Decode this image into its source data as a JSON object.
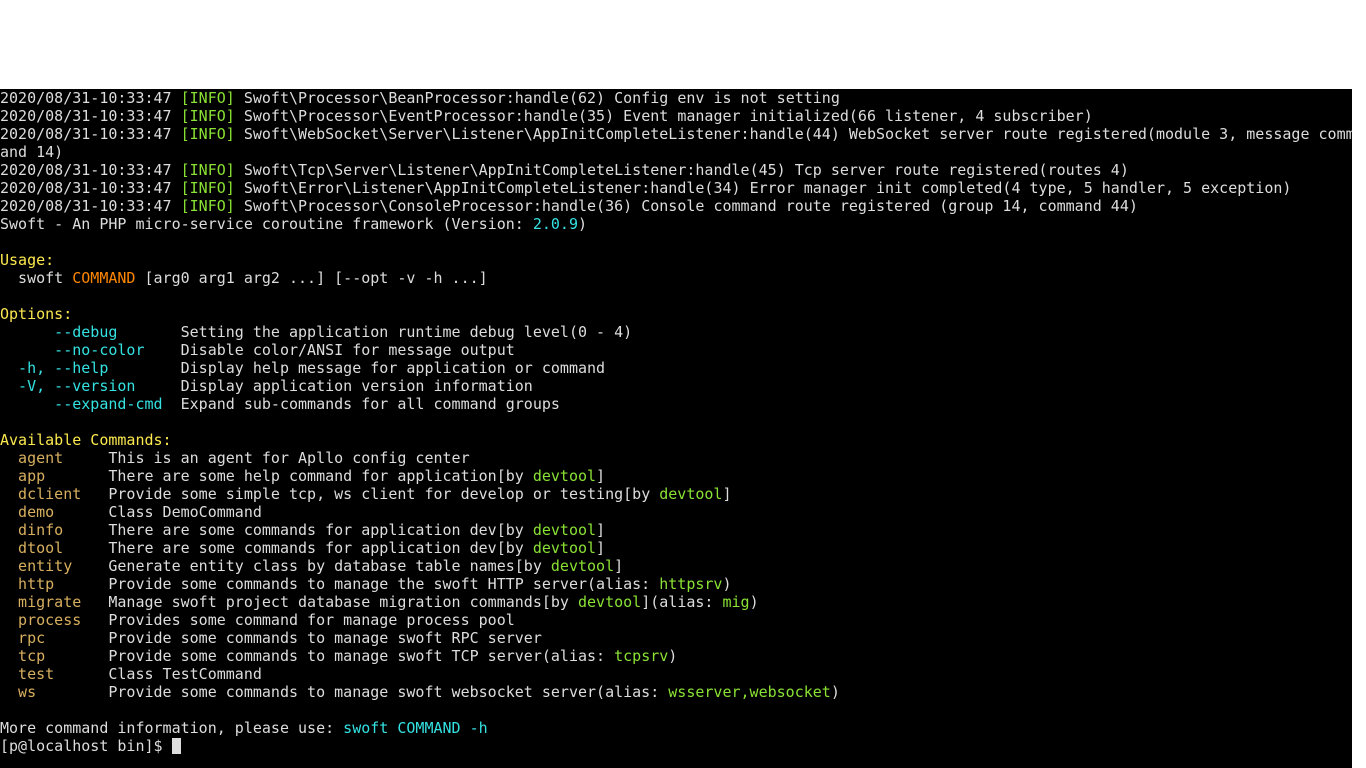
{
  "ts": "2020/08/31-10:33:47",
  "info": "[INFO]",
  "logs": {
    "l1": " Swoft\\Processor\\BeanProcessor:handle(62) Config env is not setting",
    "l2": " Swoft\\Processor\\EventProcessor:handle(35) Event manager initialized(66 listener, 4 subscriber)",
    "l3": " Swoft\\WebSocket\\Server\\Listener\\AppInitCompleteListener:handle(44) WebSocket server route registered(module 3, message comm",
    "l3b": "and 14)",
    "l4": " Swoft\\Tcp\\Server\\Listener\\AppInitCompleteListener:handle(45) Tcp server route registered(routes 4)",
    "l5": " Swoft\\Error\\Listener\\AppInitCompleteListener:handle(34) Error manager init completed(4 type, 5 handler, 5 exception)",
    "l6": " Swoft\\Processor\\ConsoleProcessor:handle(36) Console command route registered (group 14, command 44)"
  },
  "title_a": "Swoft - An PHP micro-service coroutine framework (Version: ",
  "version": "2.0.9",
  "title_b": ")",
  "usage_header": "Usage:",
  "usage_a": "  swoft ",
  "usage_cmd": "COMMAND",
  "usage_b": " [arg0 arg1 arg2 ...] [--opt -v -h ...]",
  "options_header": "Options:",
  "opt": {
    "debug_f": "      --debug",
    "debug_d": "       Setting the application runtime debug level(0 - 4)",
    "nocol_f": "      --no-color",
    "nocol_d": "    Disable color/ANSI for message output",
    "help_f": "  -h, --help",
    "help_d": "        Display help message for application or command",
    "ver_f": "  -V, --version",
    "ver_d": "     Display application version information",
    "exp_f": "      --expand-cmd",
    "exp_d": "  Expand sub-commands for all command groups"
  },
  "avail_header": "Available Commands:",
  "cmd": {
    "agent": "  agent",
    "agent_d": "     This is an agent for Apllo config center",
    "app": "  app",
    "app_d": "       There are some help command for application[by ",
    "dclient": "  dclient",
    "dclient_d": "   Provide some simple tcp, ws client for develop or testing[by ",
    "demo": "  demo",
    "demo_d": "      Class DemoCommand",
    "dinfo": "  dinfo",
    "dinfo_d": "     There are some commands for application dev[by ",
    "dtool": "  dtool",
    "dtool_d": "     There are some commands for application dev[by ",
    "entity": "  entity",
    "entity_d": "    Generate entity class by database table names[by ",
    "http": "  http",
    "http_d": "      Provide some commands to manage the swoft HTTP server(alias: ",
    "httpa": "httpsrv",
    "migrate": "  migrate",
    "migrate_d": "   Manage swoft project database migration commands[by ",
    "miga": "mig",
    "process": "  process",
    "process_d": "   Provides some command for manage process pool",
    "rpc": "  rpc",
    "rpc_d": "       Provide some commands to manage swoft RPC server",
    "tcp": "  tcp",
    "tcp_d": "       Provide some commands to manage swoft TCP server(alias: ",
    "tcpa": "tcpsrv",
    "test": "  test",
    "test_d": "      Class TestCommand",
    "ws": "  ws",
    "ws_d": "        Provide some commands to manage swoft websocket server(alias: ",
    "wsa": "wsserver,websocket"
  },
  "devtool": "devtool",
  "more_a": "More command information, please use: ",
  "more_b": "swoft COMMAND -h",
  "prompt": "[p@localhost bin]$ ",
  "alias_pfx": "](alias: "
}
